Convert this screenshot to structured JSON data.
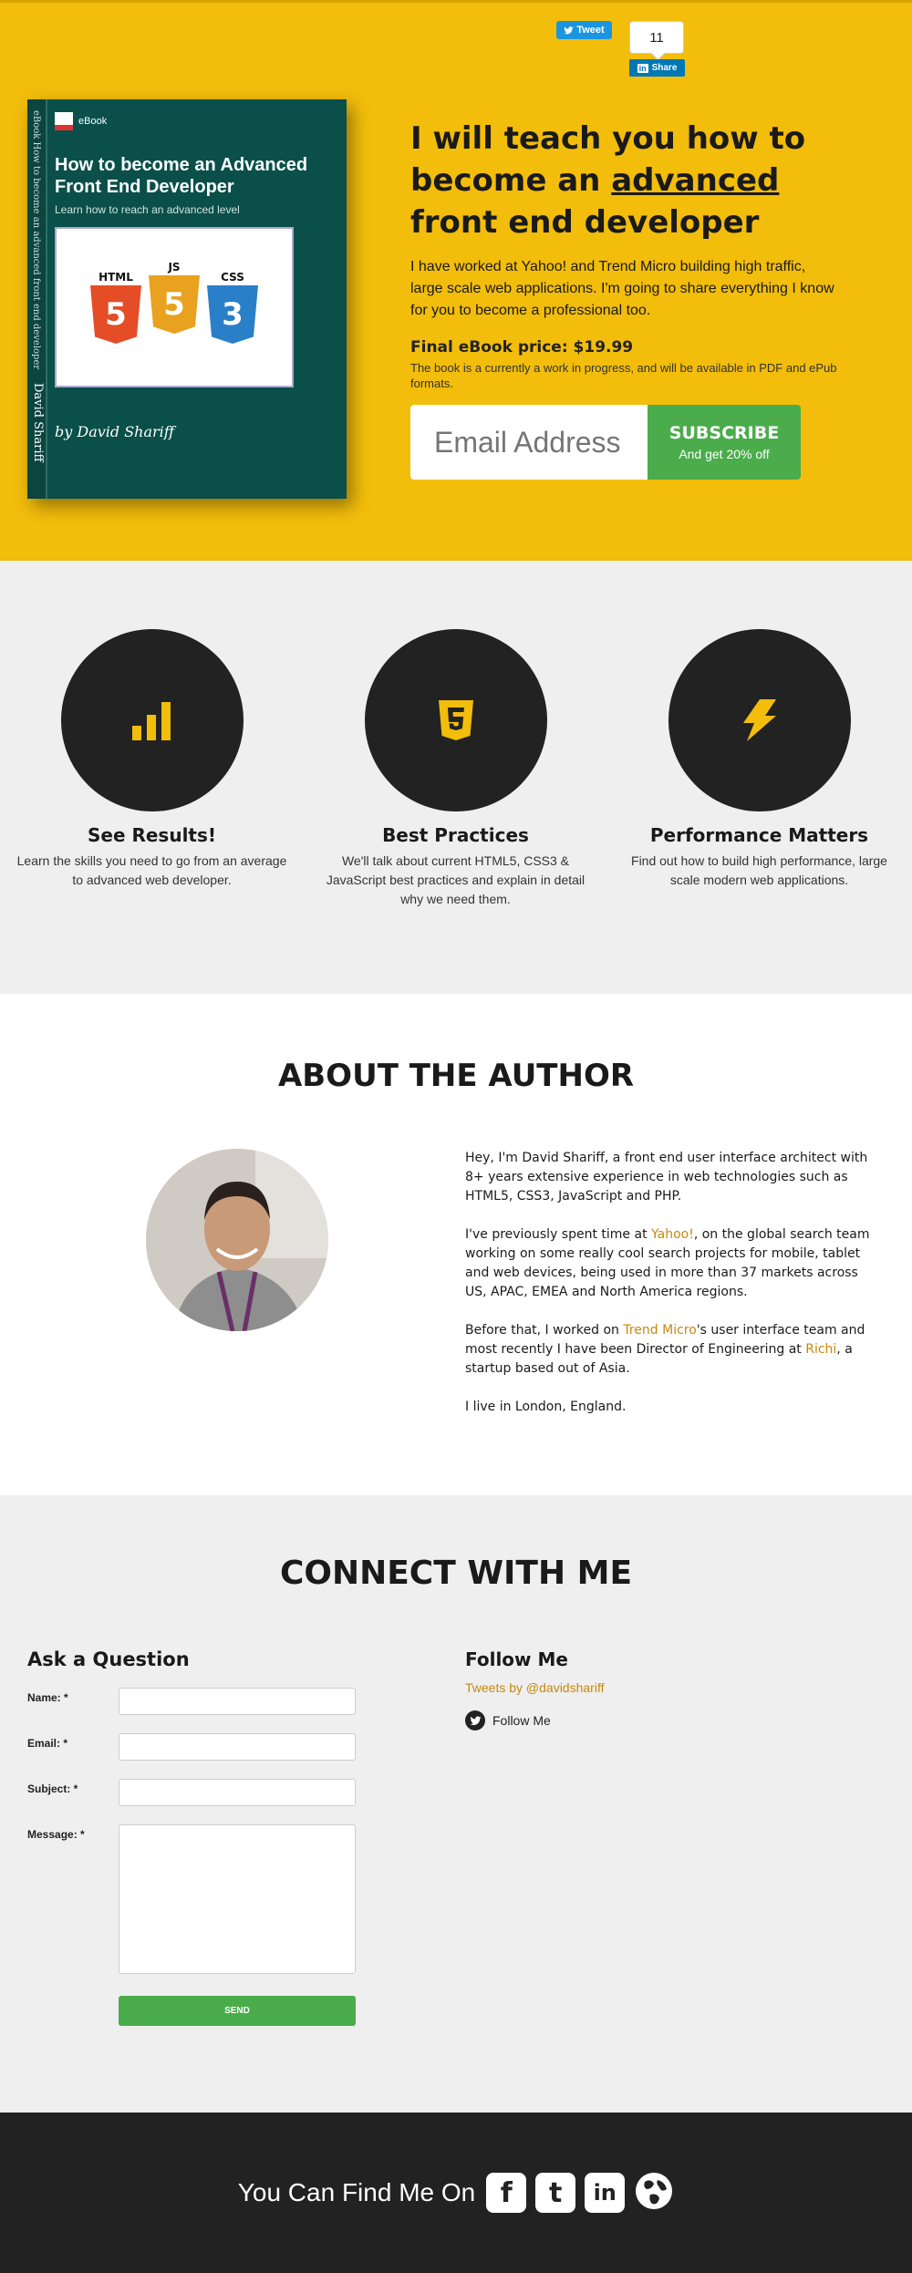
{
  "social": {
    "tweet_label": "Tweet",
    "linkedin_count": "11",
    "linkedin_share_label": "Share"
  },
  "book": {
    "logo_label": "eBook",
    "title": "How to become an Advanced Front End Developer",
    "subtitle": "Learn how to reach an advanced level",
    "spine_text": "eBook How to become an advanced front end developer",
    "spine_author": "David Shariff",
    "author": "by David Shariff",
    "badges": [
      {
        "label": "HTML",
        "number": "5",
        "color": "#e44d26"
      },
      {
        "label": "JS",
        "number": "5",
        "color": "#e8a21f"
      },
      {
        "label": "CSS",
        "number": "3",
        "color": "#2a7fc9"
      }
    ]
  },
  "hero": {
    "title_pre": "I will teach you how to become an ",
    "title_em": "advanced",
    "title_post": " front end developer",
    "description": "I have worked at Yahoo! and Trend Micro building high traffic, large scale web applications. I'm going to share everything I know for you to become a professional too.",
    "price": "Final eBook price: $19.99",
    "price_note": "The book is a currently a work in progress, and will be available in PDF and ePub formats.",
    "email_placeholder": "Email Address",
    "subscribe_label": "SUBSCRIBE",
    "subscribe_sub": "And get 20% off"
  },
  "features": [
    {
      "icon": "bar-chart-icon",
      "title": "See Results!",
      "text": "Learn the skills you need to go from an average to advanced web developer."
    },
    {
      "icon": "html5-icon",
      "title": "Best Practices",
      "text": "We'll talk about current HTML5, CSS3 & JavaScript best practices and explain in detail why we need them."
    },
    {
      "icon": "lightning-icon",
      "title": "Performance Matters",
      "text": "Find out how to build high performance, large scale modern web applications."
    }
  ],
  "about": {
    "heading": "ABOUT THE AUTHOR",
    "p1": "Hey, I'm David Shariff, a front end user interface architect with 8+ years extensive experience in web technologies such as HTML5, CSS3, JavaScript and PHP.",
    "p2_pre": "I've previously spent time at ",
    "p2_link": "Yahoo!",
    "p2_post": ", on the global search team working on some really cool search projects for mobile, tablet and web devices, being used in more than 37 markets across US, APAC, EMEA and North America regions.",
    "p3_pre": "Before that, I worked on ",
    "p3_link1": "Trend Micro",
    "p3_mid": "'s user interface team and most recently I have been Director of Engineering at ",
    "p3_link2": "Richi",
    "p3_post": ", a startup based out of Asia.",
    "p4": "I live in London, England."
  },
  "connect": {
    "heading": "CONNECT WITH ME",
    "ask_title": "Ask a Question",
    "name_label": "Name: *",
    "email_label": "Email: *",
    "subject_label": "Subject: *",
    "message_label": "Message: *",
    "send_label": "SEND",
    "follow_title": "Follow Me",
    "tweets_by": "Tweets by @davidshariff",
    "follow_me": "Follow Me"
  },
  "footer": {
    "text": "You Can Find Me On",
    "icons": [
      "facebook-icon",
      "tumblr-icon",
      "linkedin-icon",
      "globe-icon"
    ]
  },
  "colors": {
    "brand_yellow": "#f2bd0b",
    "accent_green": "#4aac4b",
    "link_orange": "#c7880b",
    "dark": "#222222"
  }
}
